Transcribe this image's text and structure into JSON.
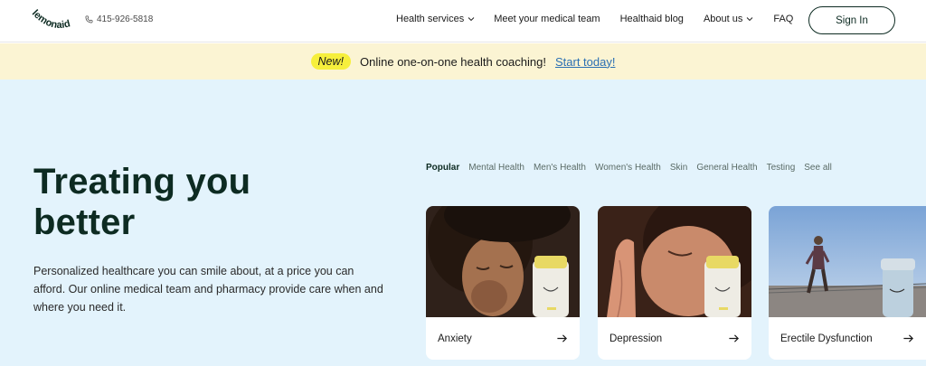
{
  "header": {
    "logo_text": "lemonaid",
    "phone": "415-926-5818",
    "nav": [
      {
        "label": "Health services",
        "has_dropdown": true
      },
      {
        "label": "Meet your medical team",
        "has_dropdown": false
      },
      {
        "label": "Healthaid blog",
        "has_dropdown": false
      },
      {
        "label": "About us",
        "has_dropdown": true
      },
      {
        "label": "FAQ",
        "has_dropdown": false
      }
    ],
    "signin_label": "Sign In"
  },
  "banner": {
    "badge": "New!",
    "text": "Online one-on-one health coaching!",
    "link": "Start today!"
  },
  "hero": {
    "title_line1": "Treating you",
    "title_line2": "better",
    "subtitle": "Personalized healthcare you can smile about, at a price you can afford. Our online medical team and pharmacy provide care when and where you need it."
  },
  "tabs": [
    "Popular",
    "Mental Health",
    "Men's Health",
    "Women's Health",
    "Skin",
    "General Health",
    "Testing",
    "See all"
  ],
  "active_tab": "Popular",
  "cards": [
    {
      "label": "Anxiety"
    },
    {
      "label": "Depression"
    },
    {
      "label": "Erectile Dysfunction"
    }
  ],
  "colors": {
    "brand_dark": "#0d2b22",
    "banner_bg": "#fbf4d3",
    "badge_yellow": "#f6ef3c",
    "hero_bg": "#e3f3fc",
    "link_blue": "#2a6fb3"
  }
}
